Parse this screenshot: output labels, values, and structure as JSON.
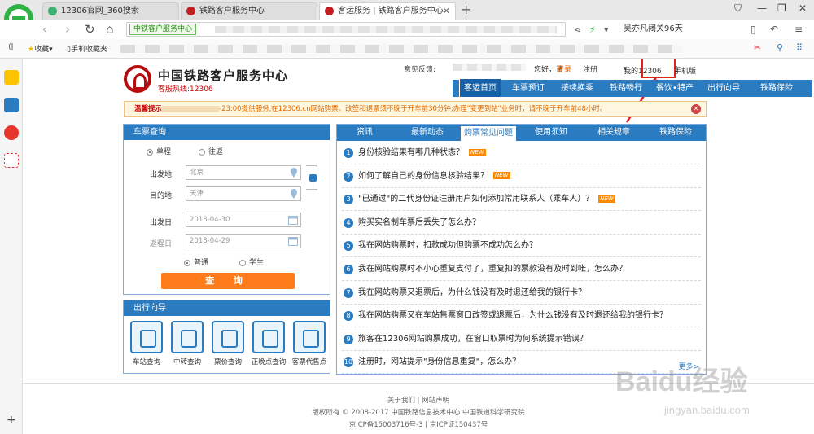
{
  "browser": {
    "tabs": [
      {
        "title": "12306官网_360搜索"
      },
      {
        "title": "铁路客户服务中心"
      },
      {
        "title": "客运服务 | 铁路客户服务中心"
      }
    ],
    "url_tag": "中铁客户服务中心",
    "search_text": "吴亦凡闭关96天",
    "bookmarks": [
      {
        "label": "收藏"
      },
      {
        "label": "手机收藏夹"
      }
    ]
  },
  "site": {
    "name": "中国铁路客户服务中心",
    "hotline": "客服热线:12306",
    "top_links": {
      "feedback": "意见反馈:",
      "greeting": "您好，请",
      "login": "登录",
      "register": "注册",
      "my12306": "我的12306",
      "mobile": "手机版"
    },
    "nav": [
      "客运首页",
      "车票预订",
      "接续换乘",
      "铁路畅行",
      "餐饮•特产",
      "出行向导",
      "铁路保险"
    ],
    "notice": {
      "label": "温馨提示",
      "text": "-23:00提供服务,在12306.cn网站购票、改签和退票须不晚于开车前30分钟;办理\"变更到站\"业务时，请不晚于开车前48小时。"
    }
  },
  "query": {
    "title": "车票查询",
    "ticket_types": [
      "单程",
      "往返"
    ],
    "from_label": "出发地",
    "from_value": "北京",
    "to_label": "目的地",
    "to_value": "天津",
    "depart_label": "出发日",
    "depart_value": "2018-04-30",
    "return_label": "返程日",
    "return_value": "2018-04-29",
    "passenger_types": [
      "普通",
      "学生"
    ],
    "button": "查 询"
  },
  "guide": {
    "title": "出行向导",
    "items": [
      "车站查询",
      "中转查询",
      "票价查询",
      "正晚点查询",
      "客票代售点"
    ]
  },
  "news": {
    "tabs": [
      "资讯",
      "最新动态",
      "购票常见问题",
      "使用须知",
      "相关规章",
      "铁路保险"
    ],
    "questions": [
      {
        "num": "1",
        "text": "身份核验结果有哪几种状态？",
        "new": "NEW"
      },
      {
        "num": "2",
        "text": "如何了解自己的身份信息核验结果？",
        "new": "NEW"
      },
      {
        "num": "3",
        "text": "\"已通过\"的二代身份证注册用户如何添加常用联系人（乘车人）？",
        "new": "NEW"
      },
      {
        "num": "4",
        "text": "购买实名制车票后丢失了怎么办？"
      },
      {
        "num": "5",
        "text": "我在网站购票时，扣款成功但购票不成功怎么办？"
      },
      {
        "num": "6",
        "text": "我在网站购票时不小心重复支付了，重复扣的票款没有及时到帐，怎么办？"
      },
      {
        "num": "7",
        "text": "我在网站购票又退票后，为什么钱没有及时退还给我的银行卡？"
      },
      {
        "num": "8",
        "text": "我在网站购票又在车站售票窗口改签或退票后，为什么钱没有及时退还给我的银行卡？"
      },
      {
        "num": "9",
        "text": "旅客在12306网站购票成功，在窗口取票时为何系统提示错误？"
      },
      {
        "num": "10",
        "text": "注册时，网站提示\"身份信息重复\"，怎么办？"
      }
    ],
    "more": "更多>"
  },
  "footer": {
    "links": "关于我们 | 网站声明",
    "copyright": "版权所有 © 2008-2017 中国铁路信息技术中心 中国铁道科学研究院",
    "icp": "京ICP备15003716号-3 | 京ICP证150437号"
  },
  "watermark": {
    "brand": "Baidu经验",
    "url": "jingyan.baidu.com"
  },
  "colors": {
    "nav_blue": "#2b7bc0",
    "accent_orange": "#ff7c1a",
    "annotation_red": "#e02020",
    "brand_red": "#b50d0d"
  }
}
